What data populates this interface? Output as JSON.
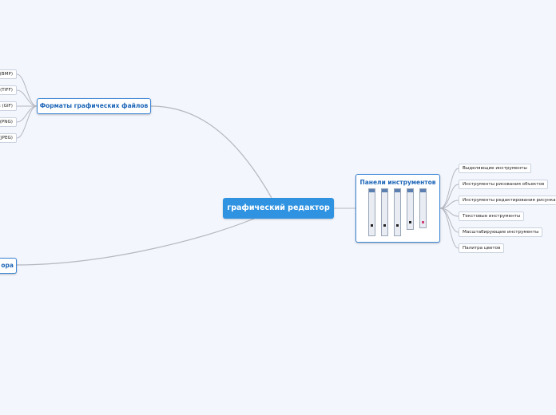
{
  "center": {
    "label": "графический редактор"
  },
  "formats": {
    "label": "Форматы графических файлов",
    "items": [
      "(BMP)",
      "(TIFF)",
      "t (GIF)",
      "(PNG)",
      "(JPEG)"
    ]
  },
  "partial": {
    "label": "ора"
  },
  "panels": {
    "label": "Панели инструментов",
    "items": [
      "Выделяющие инструменты",
      "Инструменты рисования объектов",
      "Инструменты редактирования рисунка",
      "Текстовые инструменты",
      "Масштабирующие инструменты",
      "Палитра цветов"
    ]
  },
  "colors": {
    "center_fill": "#2f93e2",
    "node_border": "#3d87d6",
    "connector": "#b4b7bf"
  }
}
